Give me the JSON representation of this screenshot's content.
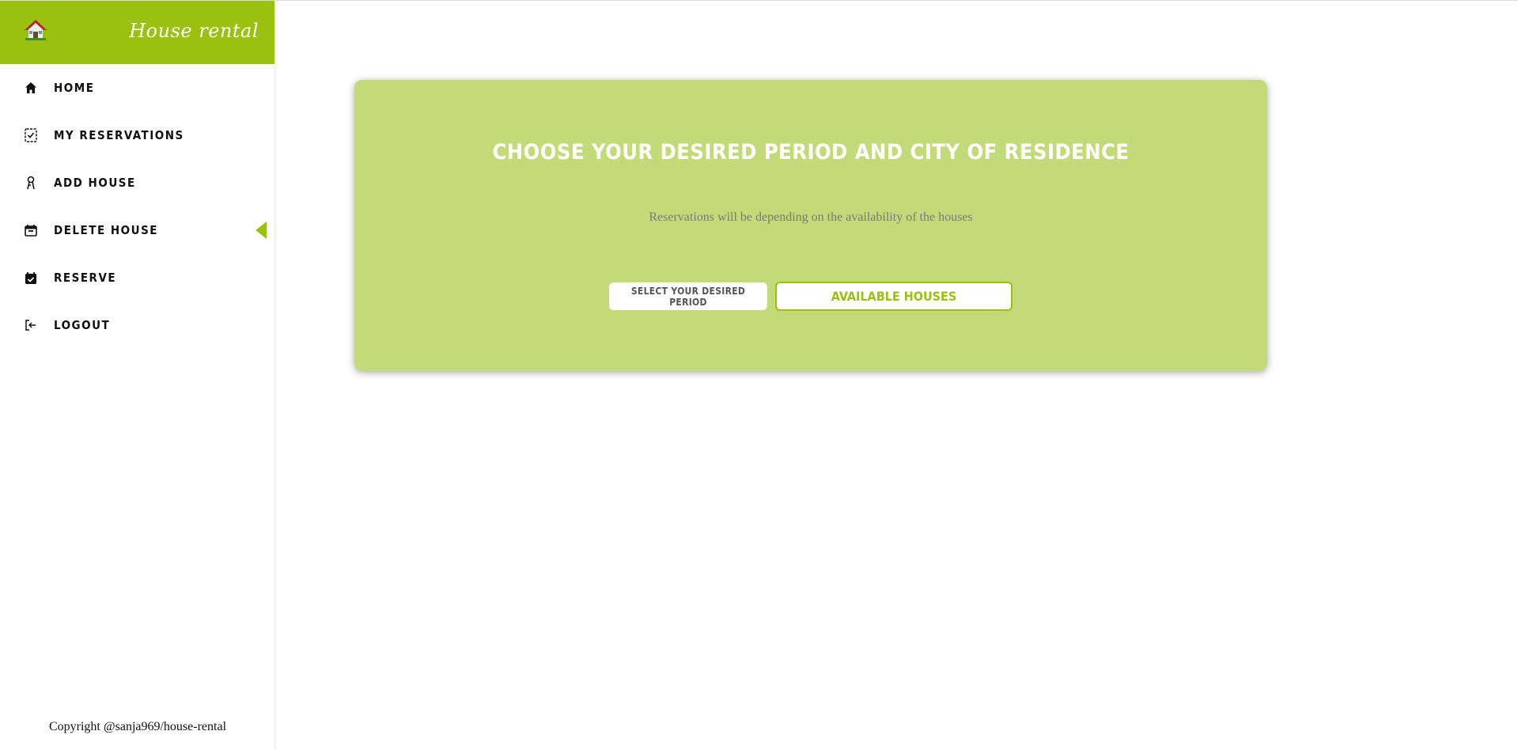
{
  "brand": {
    "title": "House rental",
    "logo_icon": "house-logo-icon",
    "color": "#9ac10f"
  },
  "sidebar": {
    "items": [
      {
        "label": "HOME",
        "icon": "home-icon"
      },
      {
        "label": "MY RESERVATIONS",
        "icon": "checklist-icon"
      },
      {
        "label": "ADD HOUSE",
        "icon": "key-icon"
      },
      {
        "label": "DELETE HOUSE",
        "icon": "calendar-delete-icon",
        "active": true
      },
      {
        "label": "RESERVE",
        "icon": "calendar-check-icon"
      },
      {
        "label": "LOGOUT",
        "icon": "logout-icon"
      }
    ],
    "copyright": "Copyright @sanja969/house-rental"
  },
  "main": {
    "title": "CHOOSE YOUR DESIRED PERIOD AND CITY OF RESIDENCE",
    "subtitle": "Reservations will be depending on the availability of the houses",
    "period_button": "SELECT YOUR DESIRED PERIOD",
    "available_button": "AVAILABLE HOUSES",
    "card_color": "#c2db78"
  }
}
